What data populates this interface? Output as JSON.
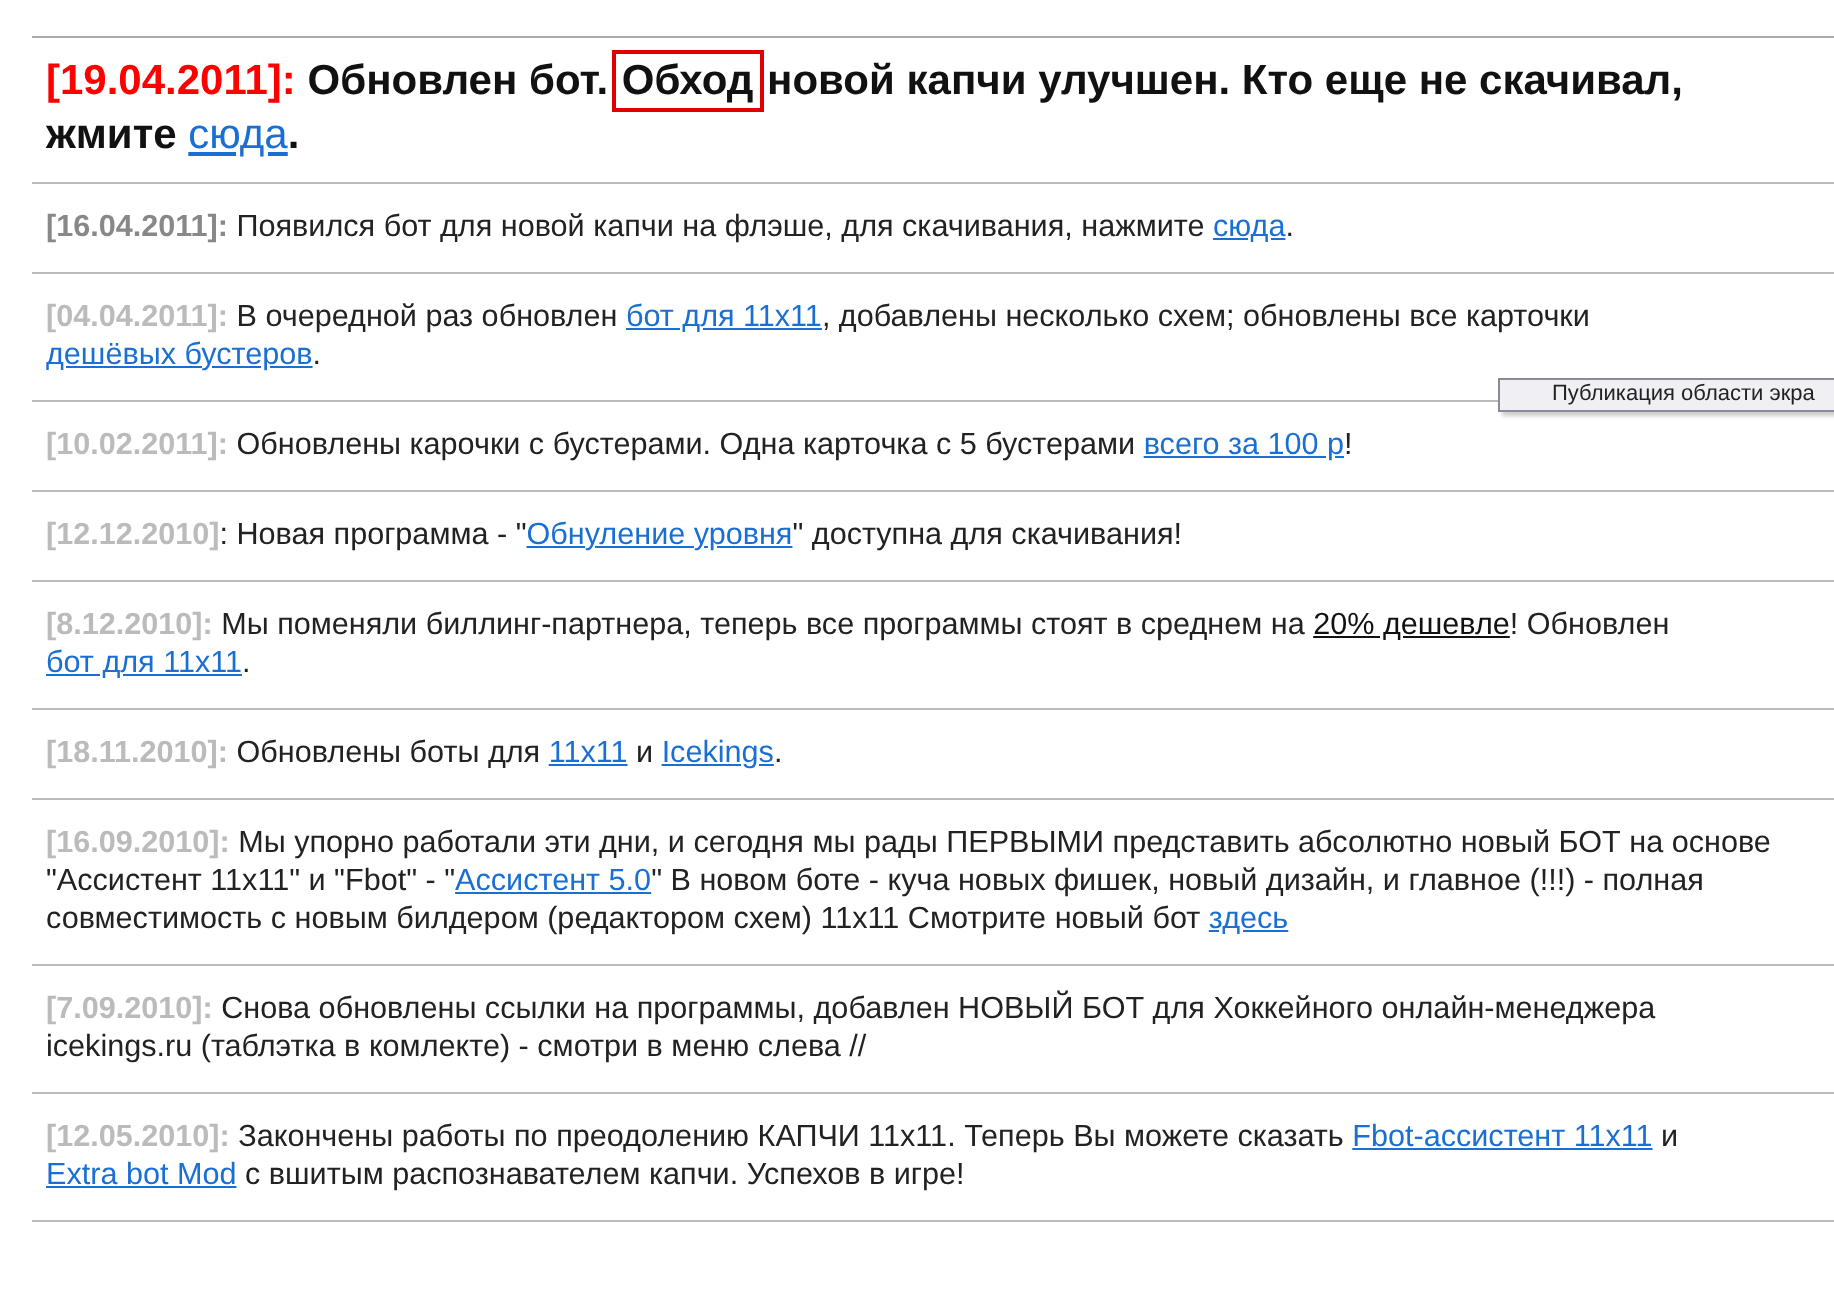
{
  "headline": {
    "date": "[19.04.2011]:",
    "color": "#ff0000",
    "segments": [
      {
        "kind": "text",
        "text": " Обновлен бот. "
      },
      {
        "kind": "boxed",
        "text": "Обход"
      },
      {
        "kind": "text",
        "text": " новой капчи улучшен. Кто еще не скачивал, жмите "
      },
      {
        "kind": "link",
        "text": "сюда"
      },
      {
        "kind": "text",
        "text": "."
      }
    ]
  },
  "news": [
    {
      "date": "[16.04.2011]:",
      "color": "#888888",
      "segments": [
        {
          "kind": "text",
          "text": " Появился бот для новой капчи на флэше, для скачивания, нажмите "
        },
        {
          "kind": "link",
          "text": "сюда"
        },
        {
          "kind": "text",
          "text": "."
        }
      ]
    },
    {
      "date": "[04.04.2011]:",
      "color": "#bbbbbb",
      "segments": [
        {
          "kind": "text",
          "text": " В очередной раз обновлен "
        },
        {
          "kind": "link",
          "text": "бот для 11x11"
        },
        {
          "kind": "text",
          "text": ", добавлены несколько схем; обновлены все карточки "
        },
        {
          "kind": "link",
          "text": "дешёвых бустеров"
        },
        {
          "kind": "text",
          "text": "."
        }
      ]
    },
    {
      "date": "[10.02.2011]:",
      "color": "#bbbbbb",
      "segments": [
        {
          "kind": "text",
          "text": " Обновлены карочки с бустерами. Одна карточка с 5 бустерами "
        },
        {
          "kind": "link",
          "text": "всего за 100 р"
        },
        {
          "kind": "text",
          "text": "!"
        }
      ]
    },
    {
      "date": "[12.12.2010]",
      "color": "#bbbbbb",
      "segments": [
        {
          "kind": "text",
          "text": ": Новая программа - \""
        },
        {
          "kind": "link",
          "text": "Обнуление уровня"
        },
        {
          "kind": "text",
          "text": "\" доступна для скачивания!"
        }
      ]
    },
    {
      "date": "[8.12.2010]:",
      "color": "#bbbbbb",
      "segments": [
        {
          "kind": "text",
          "text": " Мы поменяли биллинг-партнера, теперь все программы стоят в среднем на "
        },
        {
          "kind": "underline",
          "text": "20% дешевле"
        },
        {
          "kind": "text",
          "text": "! Обновлен "
        },
        {
          "kind": "link",
          "text": "бот для 11x11"
        },
        {
          "kind": "text",
          "text": "."
        }
      ]
    },
    {
      "date": "[18.11.2010]:",
      "color": "#bbbbbb",
      "segments": [
        {
          "kind": "text",
          "text": " Обновлены боты для "
        },
        {
          "kind": "link",
          "text": "11x11"
        },
        {
          "kind": "text",
          "text": " и "
        },
        {
          "kind": "link",
          "text": "Icekings"
        },
        {
          "kind": "text",
          "text": "."
        }
      ]
    },
    {
      "date": "[16.09.2010]:",
      "color": "#bbbbbb",
      "segments": [
        {
          "kind": "text",
          "text": "  Мы упорно работали эти дни, и сегодня мы рады ПЕРВЫМИ представить абсолютно новый БОТ на основе \"Ассистент 11x11\" и \"Fbot\"  - \""
        },
        {
          "kind": "link",
          "text": "Ассистент 5.0"
        },
        {
          "kind": "text",
          "text": "\" В новом боте - куча новых фишек, новый дизайн, и главное (!!!) - полная совместимость с новым билдером (редактором схем) 11x11 Смотрите новый бот "
        },
        {
          "kind": "link",
          "text": "здесь"
        }
      ]
    },
    {
      "date": "[7.09.2010]:",
      "color": "#bbbbbb",
      "segments": [
        {
          "kind": "text",
          "text": " Снова обновлены ссылки на программы, добавлен НОВЫЙ БОТ для Хоккейного онлайн-менеджера icekings.ru (таблэтка в комлекте) - смотри в меню слева //"
        }
      ]
    },
    {
      "date": "[12.05.2010]:",
      "color": "#bbbbbb",
      "segments": [
        {
          "kind": "text",
          "text": " Закончены работы по преодолению КАПЧИ 11x11. Теперь Вы можете сказать "
        },
        {
          "kind": "link",
          "text": "Fbot-ассистент 11x11"
        },
        {
          "kind": "text",
          "text": " и "
        },
        {
          "kind": "link",
          "text": "Extra bot Mod"
        },
        {
          "kind": "text",
          "text": " с вшитым распознавателем капчи. Успехов в игре!"
        }
      ]
    }
  ],
  "tooltip": {
    "text": "Публикация области экра"
  }
}
